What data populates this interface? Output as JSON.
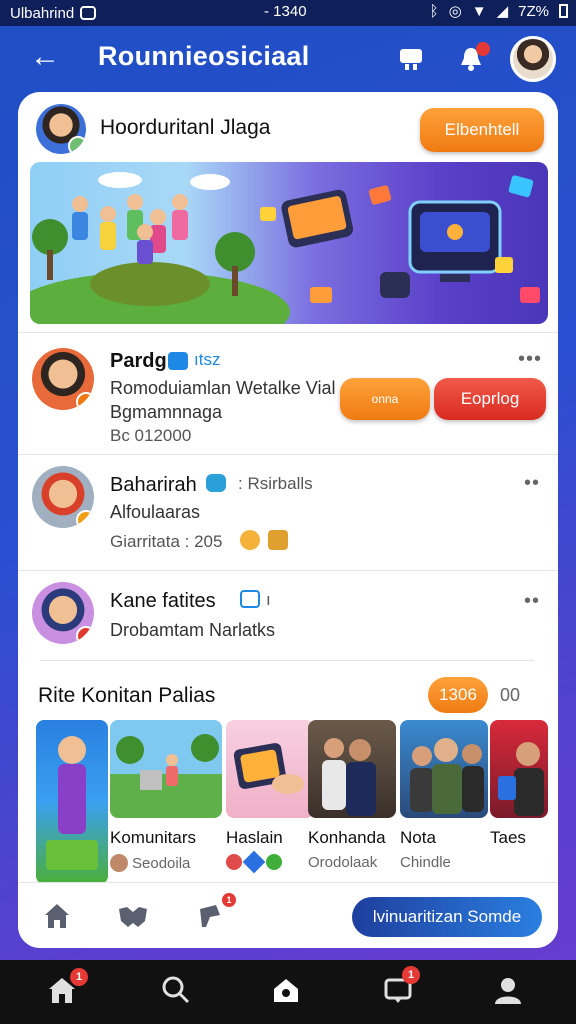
{
  "status_bar": {
    "carrier": "Ulbahrind",
    "time": "- 1340",
    "battery": "7Z%"
  },
  "app_bar": {
    "title": "Rounnieosiciaal",
    "bell_badge": "•"
  },
  "header_card": {
    "name": "Hoorduritanl Jlaga",
    "button_label": "Elbenhtell"
  },
  "posts": [
    {
      "name": "Pardg",
      "tag": "ıtsz",
      "line1": "Romoduiamlan Wetalke Vial",
      "line2": "Bgmamnnaga",
      "meta": "Bc 012000",
      "btn_small": "onna",
      "btn_large": "Eoprlog"
    },
    {
      "name": "Baharirah",
      "tag": ": Rsirballs",
      "line1": "Alfoulaaras",
      "meta": "Giarritata : 205"
    },
    {
      "name": "Kane fatites",
      "tag": "ı",
      "line1": "Drobamtam Narlatks"
    }
  ],
  "section": {
    "title": "Rite Konitan Palias",
    "count": "1306",
    "extra": "00"
  },
  "tiles": [
    {
      "title": "",
      "subtitle": ""
    },
    {
      "title": "Komunitars",
      "subtitle": "Seodoila"
    },
    {
      "title": "Haslain",
      "subtitle": ""
    },
    {
      "title": "Konhanda",
      "subtitle": "Orodolaak"
    },
    {
      "title": "Nota",
      "subtitle": "Chindle"
    },
    {
      "title": "Taes",
      "subtitle": ""
    }
  ],
  "bottom_strip": {
    "cta_label": "lvinuaritizan Somde",
    "post_badge": "1"
  },
  "nav": {
    "home_badge": "1",
    "notif_badge": "1"
  },
  "colors": {
    "accent_orange": "#f58a1f",
    "accent_red": "#e03a2e",
    "brand_blue": "#2a5bd7",
    "cta_blue": "#1e3f9e"
  }
}
